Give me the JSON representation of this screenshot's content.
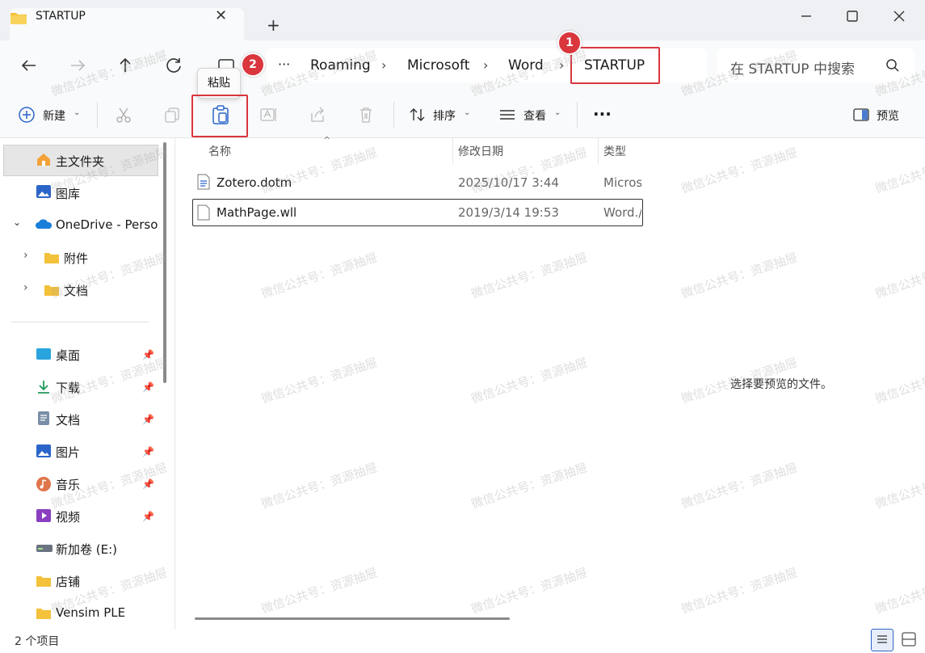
{
  "tab": {
    "title": "STARTUP",
    "close": "✕",
    "new": "+"
  },
  "window": {
    "minimize": "—",
    "maximize": "☐",
    "close": "✕"
  },
  "breadcrumb": {
    "more": "···",
    "items": [
      "Roaming",
      "Microsoft",
      "Word",
      "STARTUP"
    ]
  },
  "search": {
    "placeholder": "在 STARTUP 中搜索"
  },
  "toolbar": {
    "new_label": "新建",
    "sort_label": "排序",
    "view_label": "查看",
    "more": "···",
    "preview_label": "预览"
  },
  "tooltip": {
    "paste": "粘贴"
  },
  "annotations": {
    "badge1": "1",
    "badge2": "2",
    "color": "#d9363e"
  },
  "sidebar": {
    "items": [
      {
        "label": "主文件夹"
      },
      {
        "label": "图库"
      },
      {
        "label": "OneDrive - Personal"
      },
      {
        "label": "附件"
      },
      {
        "label": "文档"
      },
      {
        "label": "桌面"
      },
      {
        "label": "下载"
      },
      {
        "label": "文档"
      },
      {
        "label": "图片"
      },
      {
        "label": "音乐"
      },
      {
        "label": "视频"
      },
      {
        "label": "新加卷 (E:)"
      },
      {
        "label": "店铺"
      },
      {
        "label": "Vensim PLE"
      }
    ]
  },
  "filelist": {
    "columns": [
      "名称",
      "修改日期",
      "类型"
    ],
    "rows": [
      {
        "name": "Zotero.dotm",
        "date": "2025/10/17 3:44",
        "type": "Micros"
      },
      {
        "name": "MathPage.wll",
        "date": "2019/3/14 19:53",
        "type": "Word./"
      }
    ]
  },
  "preview": {
    "empty_text": "选择要预览的文件。"
  },
  "status": {
    "count": "2 个项目"
  },
  "watermark": {
    "text": "微信公共号：资源抽屉"
  }
}
